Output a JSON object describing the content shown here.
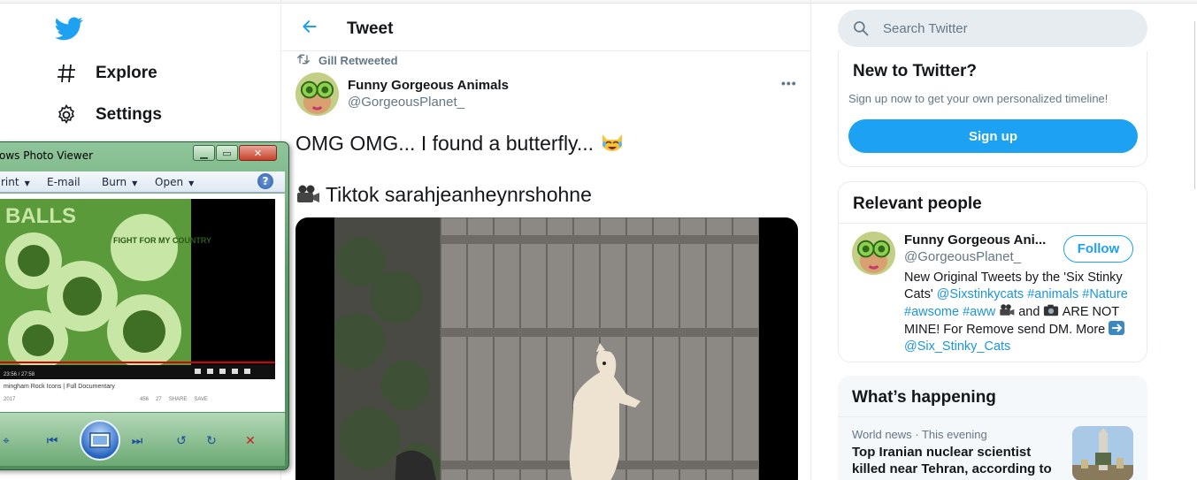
{
  "nav": {
    "logo_icon": "twitter-bird-icon",
    "items": [
      {
        "label": "Explore",
        "icon": "hash-icon"
      },
      {
        "label": "Settings",
        "icon": "gear-icon"
      }
    ]
  },
  "header": {
    "title": "Tweet",
    "back_icon": "arrow-left-icon"
  },
  "tweet": {
    "retweet_text": "Gill Retweeted",
    "author_name": "Funny Gorgeous Animals",
    "author_handle": "@GorgeousPlanet_",
    "line1": "OMG OMG... I found a butterfly...",
    "line1_emoji": "laughing-cat-emoji",
    "line2": "Tiktok sarahjeanheynrshohne",
    "line2_emoji": "movie-camera-emoji",
    "more_icon": "more-dots-icon"
  },
  "search": {
    "placeholder": "Search Twitter"
  },
  "new_to_twitter": {
    "title": "New to Twitter?",
    "subtitle": "Sign up now to get your own personalized timeline!",
    "button": "Sign up"
  },
  "relevant_people": {
    "title": "Relevant people",
    "name": "Funny Gorgeous Ani...",
    "handle": "@GorgeousPlanet_",
    "follow_label": "Follow",
    "bio_parts": [
      "New Original Tweets by the 'Six Stinky Cats'",
      "@Sixstinkycats",
      "#animals",
      "#Nature",
      "#awsome",
      "#aww",
      "and",
      "ARE NOT MINE! For Remove send DM. More",
      "@Six_Stinky_Cats"
    ]
  },
  "whats_happening": {
    "title": "What’s happening",
    "meta": "World news · This evening",
    "headline": "Top Iranian nuclear scientist killed near Tehran, according to"
  },
  "photo_viewer": {
    "title": "ows Photo Viewer",
    "menu": [
      "rint",
      "E-mail",
      "Burn",
      "Open"
    ],
    "help_label": "?",
    "image": {
      "album_title": "BALLS",
      "album_subtitle": "FIGHT FOR MY COUNTRY",
      "caption": "mingham Rock Icons | Full Documentary",
      "date": "2017",
      "time": "23:56 / 27:58",
      "likes": "456",
      "dislikes": "27",
      "share": "SHARE",
      "save": "SAVE"
    }
  },
  "colors": {
    "twitter_blue": "#1da1f2",
    "text_primary": "#14171a",
    "text_secondary": "#657786",
    "link": "#1b95e0"
  }
}
